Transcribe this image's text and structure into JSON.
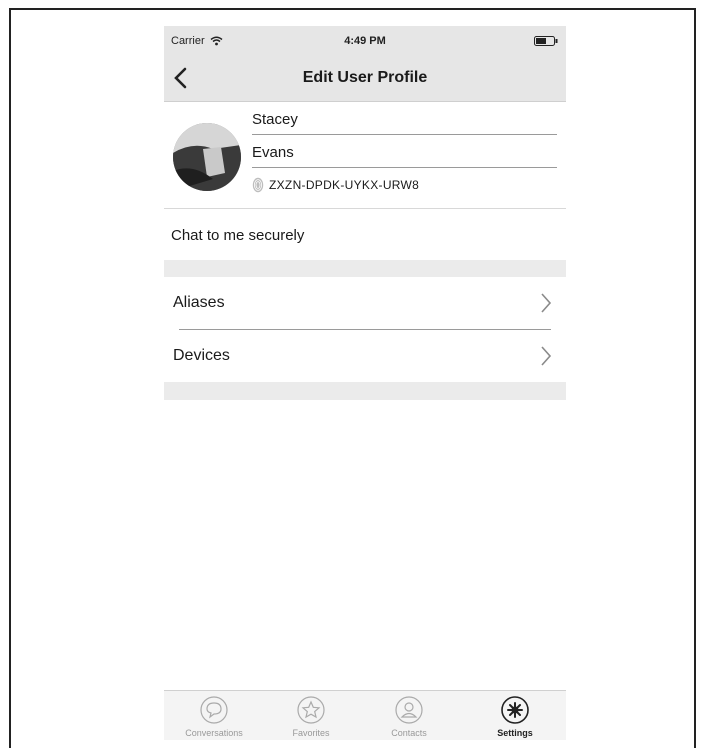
{
  "status_bar": {
    "carrier": "Carrier",
    "time": "4:49 PM"
  },
  "nav": {
    "title": "Edit User Profile"
  },
  "profile": {
    "first_name": "Stacey",
    "last_name": "Evans",
    "user_code": "ZXZN-DPDK-UYKX-URW8"
  },
  "status_message": "Chat to me securely",
  "settings_rows": [
    {
      "label": "Aliases"
    },
    {
      "label": "Devices"
    }
  ],
  "tabs": [
    {
      "label": "Conversations",
      "icon": "chat-bubble-icon"
    },
    {
      "label": "Favorites",
      "icon": "star-icon"
    },
    {
      "label": "Contacts",
      "icon": "person-icon"
    },
    {
      "label": "Settings",
      "icon": "gear-icon",
      "selected": true
    }
  ]
}
